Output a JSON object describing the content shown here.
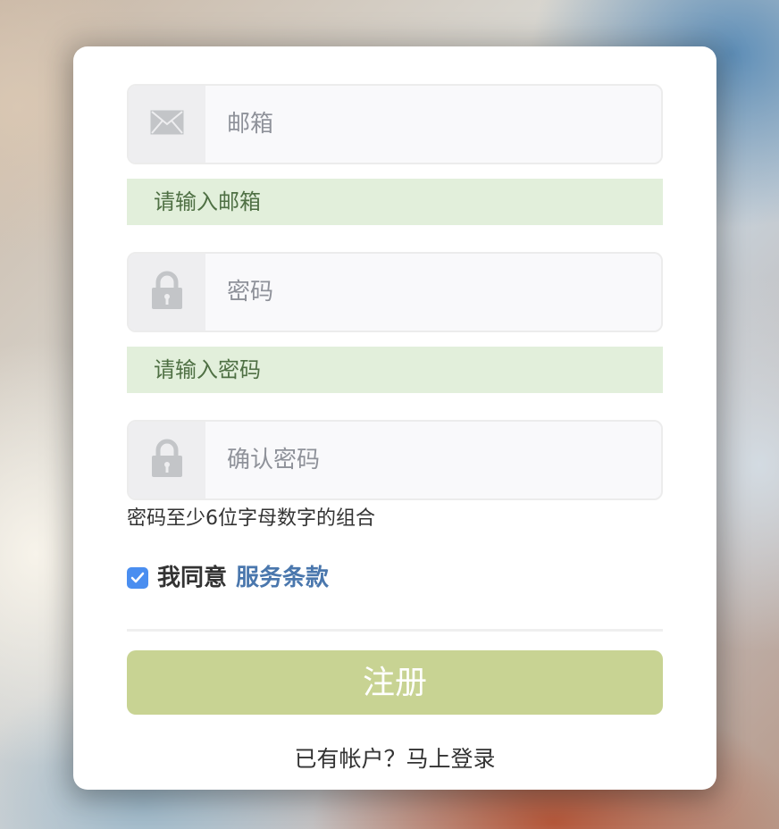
{
  "form": {
    "email": {
      "placeholder": "邮箱",
      "value": "",
      "icon": "mail-icon"
    },
    "email_alert": "请输入邮箱",
    "password": {
      "placeholder": "密码",
      "value": "",
      "icon": "lock-icon"
    },
    "password_alert": "请输入密码",
    "confirm_password": {
      "placeholder": "确认密码",
      "value": "",
      "icon": "lock-icon"
    },
    "password_hint": "密码至少6位字母数字的组合",
    "agree": {
      "checked": true,
      "text": "我同意",
      "link_text": "服务条款"
    },
    "submit_label": "注册",
    "login_link": "已有帐户？马上登录"
  },
  "colors": {
    "alert_bg": "#e2efdb",
    "alert_text": "#4f7044",
    "submit_bg": "#c8d393",
    "link": "#4a77ad",
    "checkbox": "#4a8ef0"
  }
}
